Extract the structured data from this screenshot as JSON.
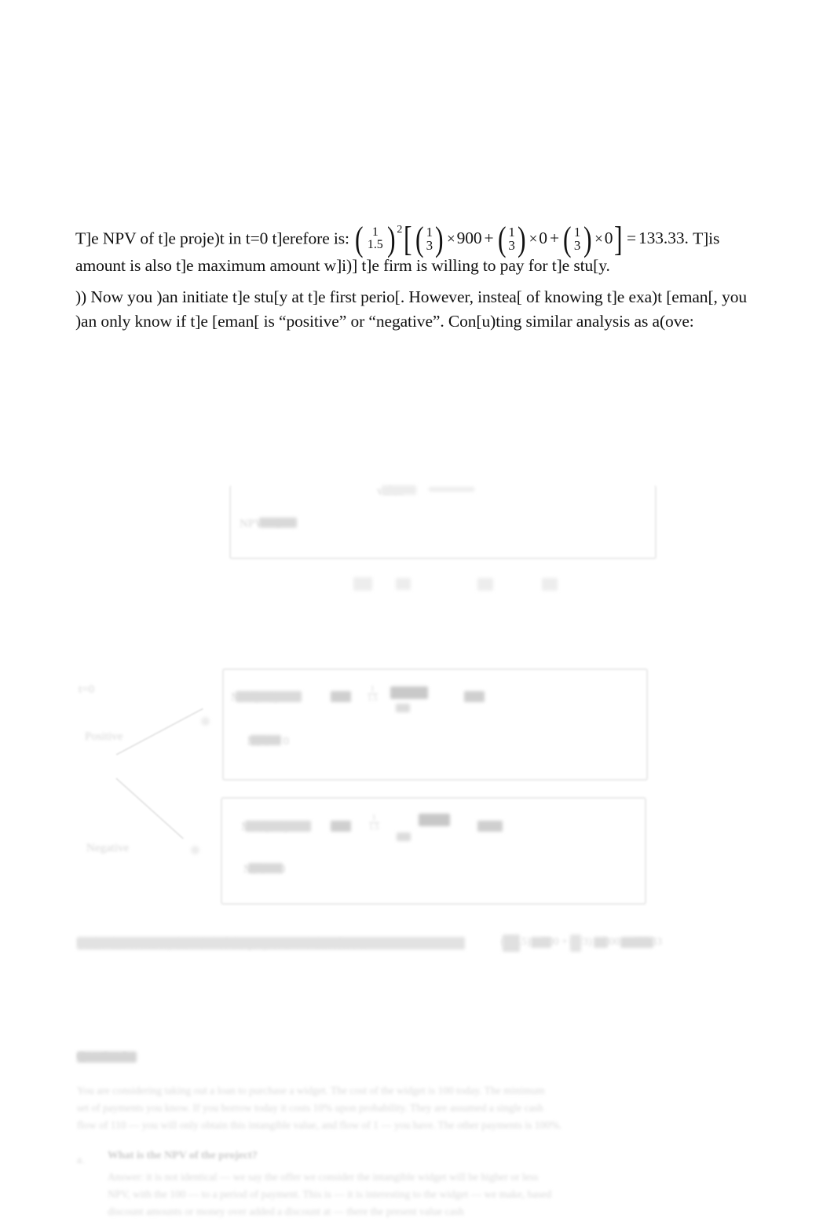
{
  "document": {
    "kind": "homework-solution-page",
    "page_background": "#ffffff"
  },
  "prose": {
    "paragraph_1": {
      "lead": "T]e NPV of t]e proje)t in t=0 t]erefore is:",
      "math": {
        "discount_numerator": "1",
        "discount_denominator": "1.5",
        "discount_exponent": "2",
        "term_1_prob_num": "1",
        "term_1_prob_den": "3",
        "term_1_times": "×",
        "term_1_value": "900",
        "plus_1": "+",
        "term_2_prob_num": "1",
        "term_2_prob_den": "3",
        "term_2_times": "×",
        "term_2_value": "0",
        "plus_2": "+",
        "term_3_prob_num": "1",
        "term_3_prob_den": "3",
        "term_3_times": "×",
        "term_3_value": "0",
        "equals": "=",
        "result": "133.33."
      },
      "tail": "T]is amount is also t]e maximum amount w]i)] t]e firm is willing to pay for t]e stu[y."
    },
    "paragraph_2": {
      "text": ")) Now you )an initiate t]e stu[y at t]e first perio[. However, instea[ of knowing t]e exa)t [eman[, you )an only know if t]e [eman[ is “positive” or “negative”. Con[u)ting similar analysis as a(ove:"
    }
  },
  "ghost_diagram": {
    "note": "heavily faded remnant artwork — decision tree and equation boxes",
    "top_box": {
      "inner_label": "NPV = 0",
      "header_smudge": "value"
    },
    "tick_row": [
      "0",
      "1",
      "2",
      "3"
    ],
    "root_label": "t=0",
    "branch_positive_label": "Positive",
    "branch_negative_label": "Negative",
    "positive_box": {
      "line_1_left": "NPV(t=1) =",
      "line_1_factor": "900",
      "line_1_frac_num": "1",
      "line_1_frac_den": "1.5",
      "line_1_result": "600",
      "line_2": "NPV = 0"
    },
    "negative_box": {
      "line_1_left": "NPV(t=1) =",
      "line_1_factor": "900",
      "line_1_frac_num": "1",
      "line_1_frac_den": "1.5",
      "line_1_result": "-300",
      "line_2": "NPV = 0"
    },
    "summary_line": {
      "text": "Under this scenario, the NPV of the project at t=0 therefore is:",
      "math": "(1/1.5) × 900 + (1/3) × 300 = 433.33"
    }
  },
  "ghost_bottom": {
    "question_heading": "Question 3",
    "body_line_1": "You are considering taking out a loan to purchase a widget. The cost of the widget is 100 today. The minimum",
    "body_line_2": "set of payments you know. If you borrow today it costs 10% upon probability. They are assumed a single cash",
    "body_line_3": "flow of 110 — you will only obtain this intangible value, and flow of 1 — you have. The other payments is 100%.",
    "sub_a_label": "a.",
    "sub_a_heading": "What is the NPV of the project?",
    "sub_a_line_1": "Answer: it is not identical — we say the offer we consider the intangible widget will be higher or less",
    "sub_a_line_2": "NPV, with the 100 — to a period of payment. This is — it is interesting to the widget — we make, based",
    "sub_a_line_3": "discount amounts or money over added a discount at — there the present value cash"
  }
}
